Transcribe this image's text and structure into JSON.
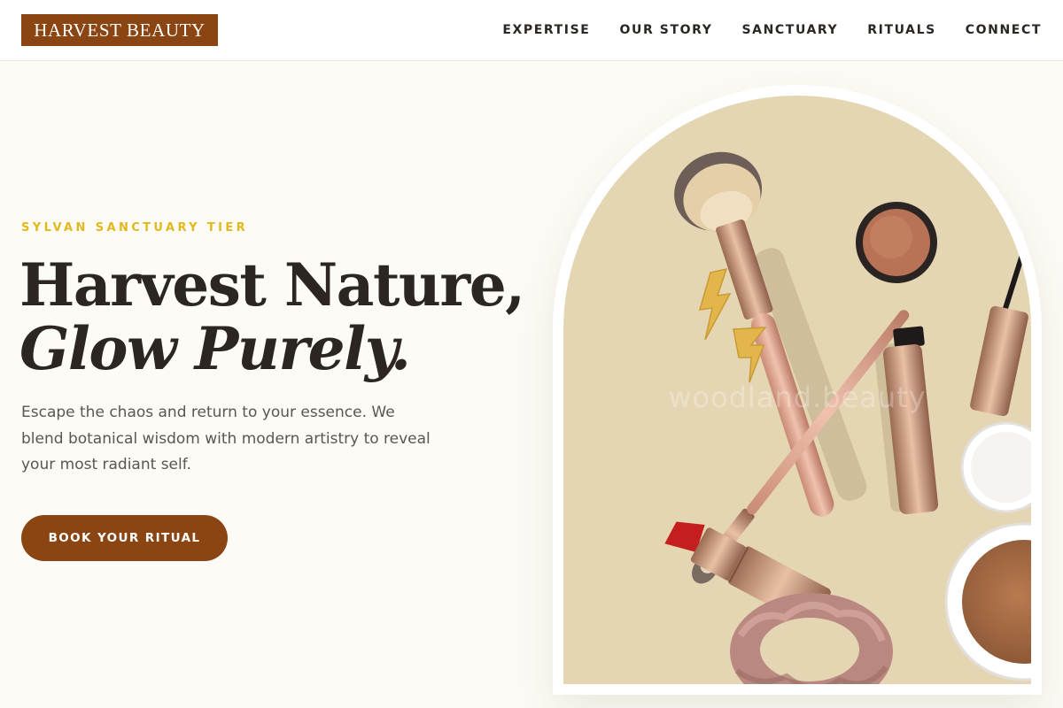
{
  "brand": {
    "logo": "HARVEST BEAUTY",
    "accent": "#8b4513",
    "gold": "#e3b81c"
  },
  "nav": {
    "items": [
      {
        "label": "EXPERTISE"
      },
      {
        "label": "OUR STORY"
      },
      {
        "label": "SANCTUARY"
      },
      {
        "label": "RITUALS"
      },
      {
        "label": "CONNECT"
      }
    ]
  },
  "hero": {
    "eyebrow": "SYLVAN SANCTUARY TIER",
    "headline_line1": "Harvest Nature,",
    "headline_line2": "Glow Purely.",
    "lede": "Escape the chaos and return to your essence. We blend botanical wisdom with modern artistry to reveal your most radiant self.",
    "cta": "BOOK YOUR RITUAL"
  },
  "image": {
    "watermark": "woodland.beauty",
    "icons": [
      "makeup-brush-icon",
      "lipstick-icon",
      "mascara-icon",
      "compact-icon",
      "scrunchie-icon",
      "lightning-earring-icon"
    ]
  }
}
